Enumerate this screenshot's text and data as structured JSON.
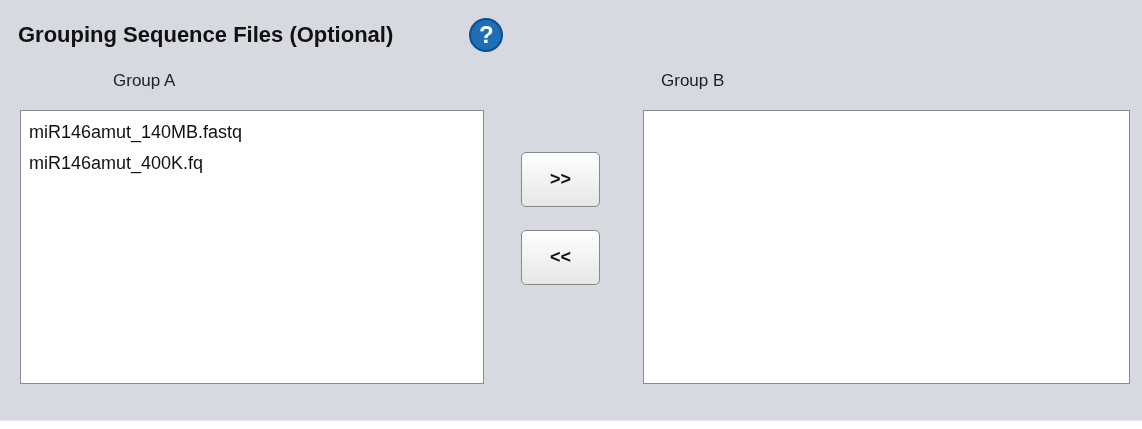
{
  "title": "Grouping Sequence Files (Optional)",
  "help_icon": "?",
  "group_a": {
    "label": "Group A",
    "items": [
      "miR146amut_140MB.fastq",
      "miR146amut_400K.fq"
    ]
  },
  "buttons": [
    ">>",
    "<<"
  ],
  "group_b": {
    "label": "Group B"
  }
}
